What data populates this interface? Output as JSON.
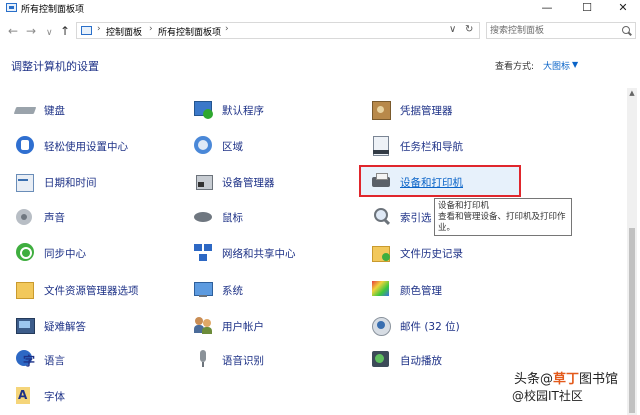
{
  "window": {
    "title": "所有控制面板项",
    "minimize": "—",
    "maximize": "☐",
    "close": "✕"
  },
  "nav": {
    "back": "←",
    "forward": "→",
    "recent": "∨",
    "up": "↑"
  },
  "address": {
    "breadcrumbs": [
      "控制面板",
      "所有控制面板项"
    ],
    "separator": "›",
    "dropdown": "∨",
    "refresh": "↻"
  },
  "search": {
    "placeholder": "搜索控制面板"
  },
  "heading": "调整计算机的设置",
  "view": {
    "label": "查看方式:",
    "value": "大图标",
    "arrow": "▼"
  },
  "columns": [
    [
      "键盘",
      "轻松使用设置中心",
      "日期和时间",
      "声音",
      "同步中心",
      "文件资源管理器选项",
      "疑难解答",
      "语言",
      "字体"
    ],
    [
      "默认程序",
      "区域",
      "设备管理器",
      "鼠标",
      "网络和共享中心",
      "系统",
      "用户帐户",
      "语音识别"
    ],
    [
      "凭据管理器",
      "任务栏和导航",
      "设备和打印机",
      "索引选",
      "文件历史记录",
      "颜色管理",
      "邮件 (32 位)",
      "自动播放"
    ]
  ],
  "tooltip": {
    "title": "设备和打印机",
    "text": "查看和管理设备、打印机及打印作业。"
  },
  "watermark": {
    "line1_a": "头条",
    "line1_b": "@",
    "line1_c": "草丁",
    "line1_d": "图书馆",
    "line2": "@校园IT社区"
  },
  "colors": {
    "link": "#1e3287",
    "highlight_border": "#e0262c",
    "accent": "#0a64c8"
  }
}
